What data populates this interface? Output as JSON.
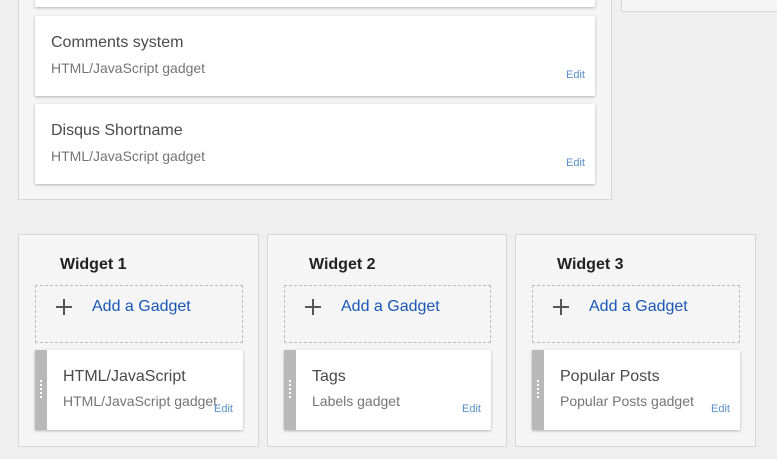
{
  "main_section": {
    "gadgets": [
      {
        "title": "Comments system",
        "subtitle": "HTML/JavaScript gadget",
        "edit": "Edit"
      },
      {
        "title": "Disqus Shortname",
        "subtitle": "HTML/JavaScript gadget",
        "edit": "Edit"
      }
    ]
  },
  "widgets": [
    {
      "heading": "Widget 1",
      "add_label": "Add a Gadget",
      "gadget": {
        "title": "HTML/JavaScript",
        "subtitle": "HTML/JavaScript gadget",
        "edit": "Edit"
      }
    },
    {
      "heading": "Widget 2",
      "add_label": "Add a Gadget",
      "gadget": {
        "title": "Tags",
        "subtitle": "Labels gadget",
        "edit": "Edit"
      }
    },
    {
      "heading": "Widget 3",
      "add_label": "Add a Gadget",
      "gadget": {
        "title": "Popular Posts",
        "subtitle": "Popular Posts gadget",
        "edit": "Edit"
      }
    }
  ],
  "icons": {
    "add": "plus-icon",
    "drag": "drag-handle-icon"
  },
  "colors": {
    "link": "#1a56b8",
    "edit": "#5b8ec9",
    "handle": "#b8b8b8"
  }
}
